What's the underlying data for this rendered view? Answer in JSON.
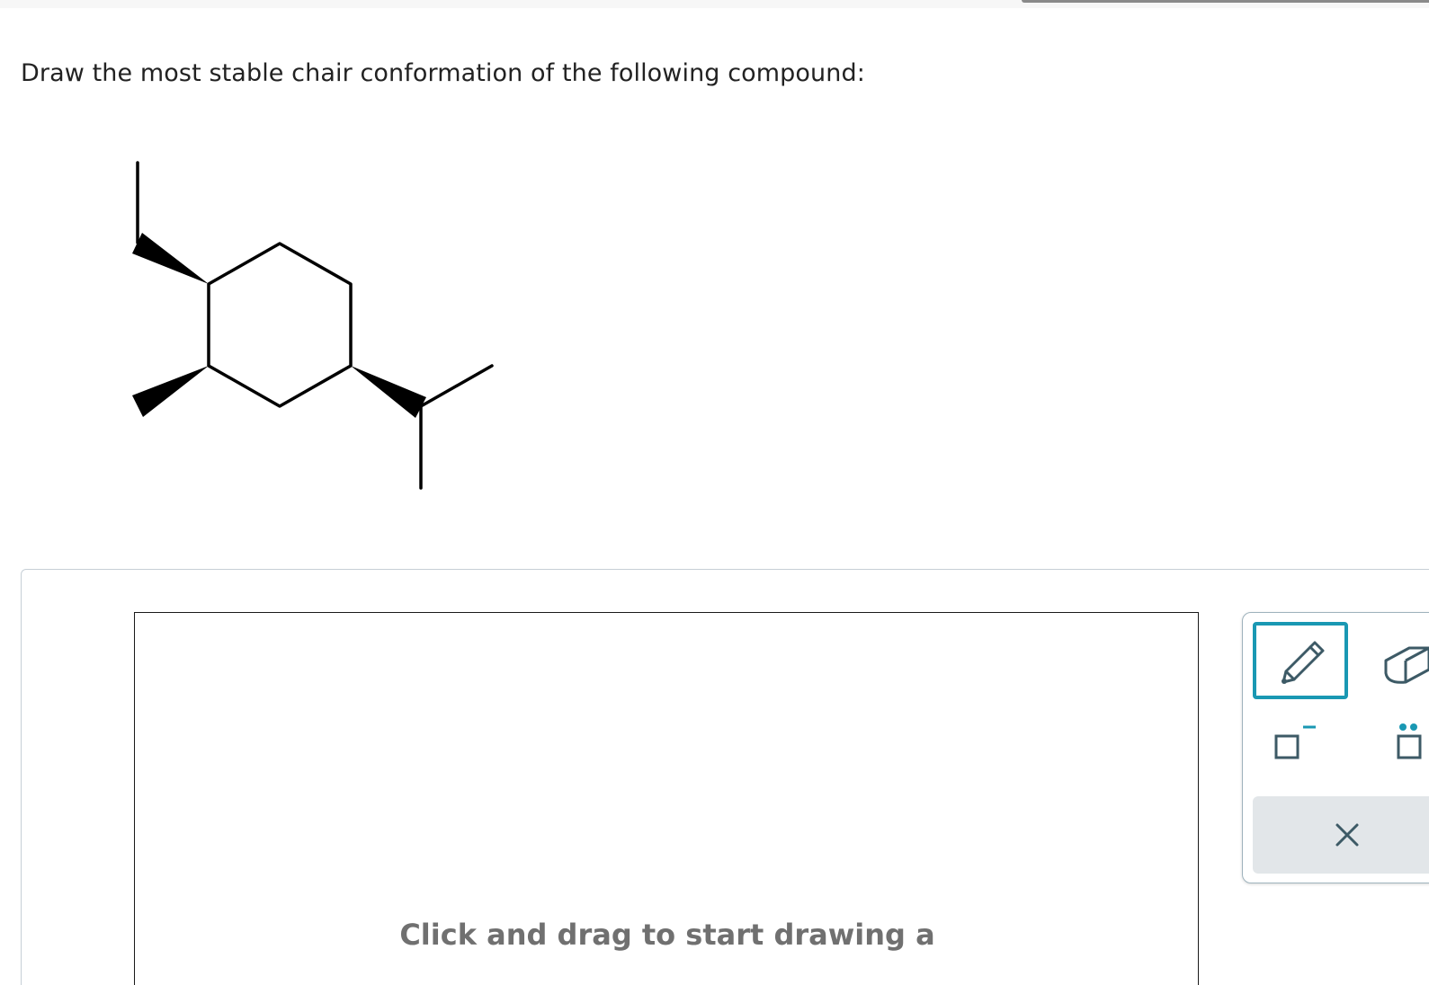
{
  "question": {
    "text": "Draw the most stable chair conformation of the following compound:"
  },
  "drawing_area": {
    "hint": "Click and drag to start drawing a"
  },
  "toolbar": {
    "accent_color": "#1a98b3",
    "icon_color": "#3d5a66",
    "tools": [
      {
        "name": "pencil",
        "icon": "pencil-icon",
        "selected": true
      },
      {
        "name": "eraser",
        "icon": "eraser-icon",
        "selected": false
      },
      {
        "name": "negative-charge",
        "icon": "charge-icon",
        "selected": false
      },
      {
        "name": "lone-pair",
        "icon": "lone-pair-icon",
        "selected": false
      },
      {
        "name": "clear",
        "icon": "close-icon",
        "selected": false
      }
    ]
  }
}
